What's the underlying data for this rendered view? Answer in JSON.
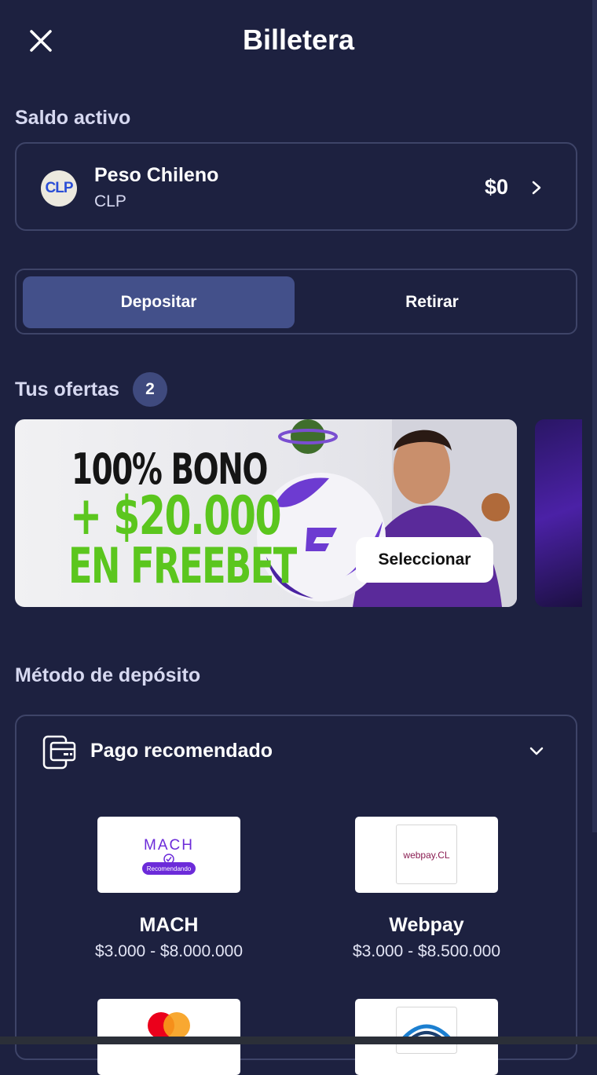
{
  "header": {
    "title": "Billetera"
  },
  "balance": {
    "section_label": "Saldo activo",
    "badge": "CLP",
    "currency_name": "Peso Chileno",
    "currency_code": "CLP",
    "amount": "$0"
  },
  "tabs": [
    {
      "label": "Depositar",
      "active": true
    },
    {
      "label": "Retirar",
      "active": false
    }
  ],
  "offers": {
    "label": "Tus ofertas",
    "count": "2",
    "banner": {
      "line1": "100% BONO",
      "line2": "+ $20.000",
      "line3": "EN FREEBET",
      "button": "Seleccionar"
    }
  },
  "deposit": {
    "section_label": "Método de depósito",
    "group_title": "Pago recomendado",
    "methods": [
      {
        "name": "MACH",
        "range": "$3.000 - $8.000.000",
        "logo_text": "MACH",
        "tag": "Recomendando"
      },
      {
        "name": "Webpay",
        "range": "$3.000 - $8.500.000",
        "logo_text": "webpay.CL"
      }
    ]
  },
  "colors": {
    "background": "#1d2140",
    "active_tab": "#43508a",
    "border": "#3e4468",
    "promo_green": "#5bc61e",
    "mach_purple": "#6c2bd9"
  },
  "icons": [
    "close-icon",
    "chevron-right-icon",
    "wallet-card-icon",
    "chevron-down-icon",
    "mastercard-icon",
    "bank-icon"
  ]
}
